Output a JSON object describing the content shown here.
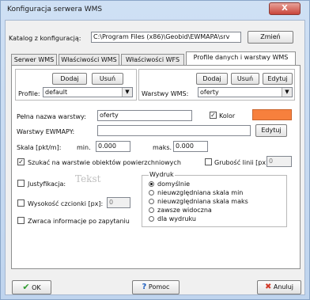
{
  "window": {
    "title": "Konfiguracja serwera WMS",
    "close_glyph": "X"
  },
  "config": {
    "label": "Katalog z konfiguracją:",
    "value": "C:\\Program Files (x86)\\Geobid\\EWMAPA\\srv",
    "change_button": "Zmień"
  },
  "tabs": [
    {
      "label": "Serwer WMS",
      "active": false
    },
    {
      "label": "Właściwości WMS",
      "active": false
    },
    {
      "label": "Właściwości WFS",
      "active": false
    },
    {
      "label": "Profile danych i warstwy WMS",
      "active": true
    }
  ],
  "profiles": {
    "add_button": "Dodaj",
    "remove_button": "Usuń",
    "label": "Profile:",
    "selected": "default"
  },
  "layers": {
    "add_button": "Dodaj",
    "remove_button": "Usuń",
    "edit_button": "Edytuj",
    "label": "Warstwy WMS:",
    "selected": "oferty"
  },
  "form": {
    "full_name_label": "Pełna nazwa warstwy:",
    "full_name_value": "oferty",
    "color_label": "Kolor",
    "color_checked": true,
    "color_value": "#f7803d",
    "ewmapa_label": "Warstwy EWMAPY:",
    "ewmapa_value": "",
    "ewmapa_edit_button": "Edytuj",
    "scale_label": "Skala [pkt/m]:",
    "scale_min_label": "min.",
    "scale_min_value": "0.000",
    "scale_max_label": "maks.",
    "scale_max_value": "0.000",
    "search_surface_label": "Szukać na warstwie obiektów powierzchniowych",
    "search_surface_checked": true,
    "line_width_label": "Grubość linii [px]:",
    "line_width_value": "0",
    "justify_label": "Justyfikacja:",
    "justify_preview": "Tekst",
    "font_height_label": "Wysokość czcionki [px]:",
    "font_height_value": "0",
    "returns_info_label": "Zwraca informacje po zapytaniu"
  },
  "print": {
    "title": "Wydruk",
    "options": [
      {
        "label": "domyślnie",
        "selected": true
      },
      {
        "label": "nieuwzględniana skala min",
        "selected": false
      },
      {
        "label": "nieuwzględniana skala maks",
        "selected": false
      },
      {
        "label": "zawsze widoczna",
        "selected": false
      },
      {
        "label": "dla wydruku",
        "selected": false
      }
    ]
  },
  "footer": {
    "ok": "OK",
    "help": "Pomoc",
    "cancel": "Anuluj"
  },
  "icons": {
    "ok": "checkmark-icon",
    "help": "question-mark-icon",
    "cancel": "x-icon"
  }
}
